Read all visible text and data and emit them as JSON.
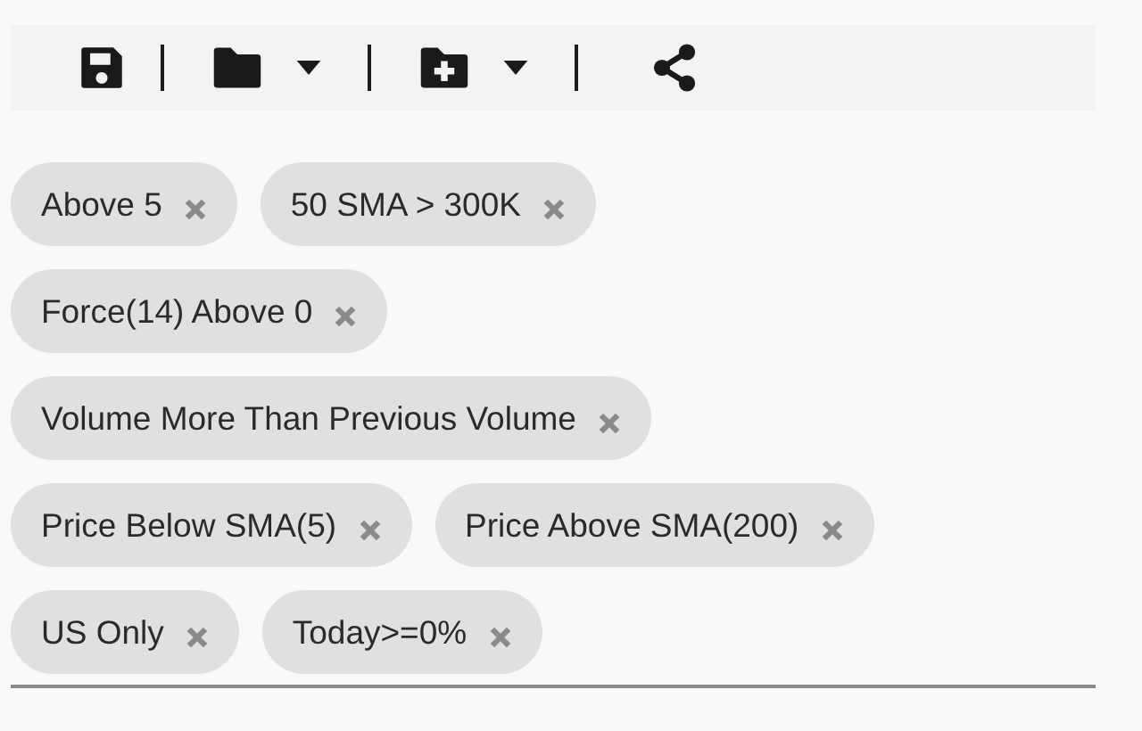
{
  "toolbar": {
    "items": [
      {
        "kind": "save"
      },
      {
        "kind": "separator"
      },
      {
        "kind": "folder",
        "dropdown": true
      },
      {
        "kind": "separator"
      },
      {
        "kind": "folder-plus",
        "dropdown": true
      },
      {
        "kind": "separator"
      },
      {
        "kind": "share"
      }
    ]
  },
  "filter_groups": [
    {
      "chips": [
        {
          "label": "Above 5"
        },
        {
          "label": "50 SMA > 300K"
        }
      ]
    },
    {
      "chips": [
        {
          "label": "Force(14) Above 0"
        }
      ]
    },
    {
      "chips": [
        {
          "label": "Volume More Than Previous Volume"
        }
      ]
    },
    {
      "chips": [
        {
          "label": "Price Below SMA(5)"
        },
        {
          "label": "Price Above SMA(200)"
        }
      ]
    },
    {
      "chips": [
        {
          "label": "US Only"
        },
        {
          "label": "Today>=0%"
        }
      ]
    }
  ]
}
